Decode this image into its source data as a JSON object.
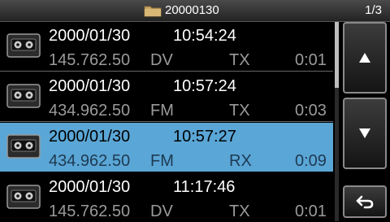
{
  "header": {
    "folder_name": "20000130",
    "page_indicator": "1/3"
  },
  "recordings": [
    {
      "date": "2000/01/30",
      "time": "10:54:24",
      "frequency": "145.762.50",
      "mode": "DV",
      "direction": "TX",
      "duration": "0:01",
      "selected": false
    },
    {
      "date": "2000/01/30",
      "time": "10:57:24",
      "frequency": "434.962.50",
      "mode": "FM",
      "direction": "TX",
      "duration": "0:03",
      "selected": false
    },
    {
      "date": "2000/01/30",
      "time": "10:57:27",
      "frequency": "434.962.50",
      "mode": "FM",
      "direction": "RX",
      "duration": "0:09",
      "selected": true
    },
    {
      "date": "2000/01/30",
      "time": "11:17:46",
      "frequency": "145.762.50",
      "mode": "DV",
      "direction": "TX",
      "duration": "0:01",
      "selected": false
    }
  ],
  "scroll": {
    "visible_fraction": 0.33,
    "position": 0.0
  },
  "icons": {
    "folder": "folder-icon",
    "recording": "voice-recording-tape-icon",
    "up": "arrow-up-icon",
    "down": "arrow-down-icon",
    "back": "return-icon"
  },
  "colors": {
    "selected_row": "#5aa6d6",
    "folder": "#c9a766"
  }
}
